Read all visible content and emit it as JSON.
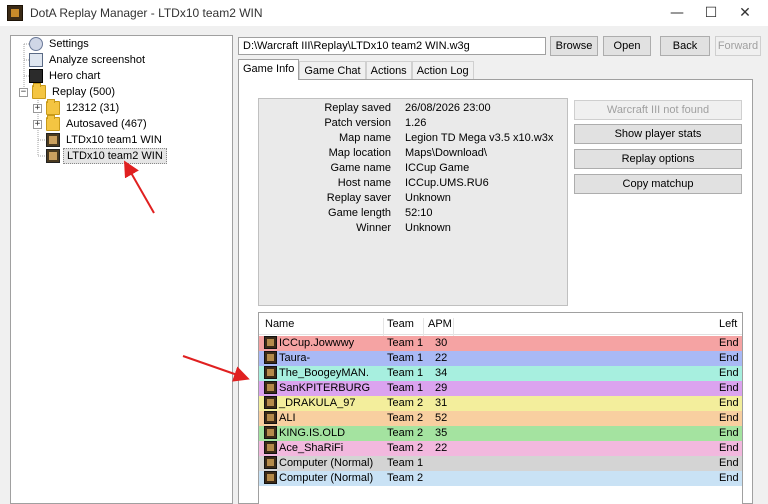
{
  "window": {
    "title": "DotA Replay Manager - LTDx10 team2 WIN",
    "minimize": "—",
    "maximize": "☐",
    "close": "✕"
  },
  "tree": {
    "items": [
      {
        "label": "Settings",
        "icon": "gear-icon"
      },
      {
        "label": "Analyze screenshot",
        "icon": "screenshot-icon"
      },
      {
        "label": "Hero chart",
        "icon": "hero-chart-icon"
      },
      {
        "label": "Replay (500)",
        "icon": "folder-icon",
        "expander": "−"
      },
      {
        "label": "12312 (31)",
        "icon": "folder-icon",
        "expander": "+"
      },
      {
        "label": "Autosaved (467)",
        "icon": "folder-icon",
        "expander": "+"
      },
      {
        "label": "LTDx10 team1 WIN",
        "icon": "replay-icon"
      },
      {
        "label": "LTDx10 team2 WIN",
        "icon": "replay-icon",
        "selected": true
      }
    ]
  },
  "toolbar": {
    "path": "D:\\Warcraft III\\Replay\\LTDx10 team2 WIN.w3g",
    "browse": "Browse",
    "open": "Open",
    "back": "Back",
    "forward": "Forward"
  },
  "tabs": [
    "Game Info",
    "Game Chat",
    "Actions",
    "Action Log"
  ],
  "info": [
    {
      "key": "Replay saved",
      "value": "26/08/2026 23:00"
    },
    {
      "key": "Patch version",
      "value": "1.26"
    },
    {
      "key": "Map name",
      "value": "Legion TD Mega v3.5 x10.w3x"
    },
    {
      "key": "Map location",
      "value": "Maps\\Download\\"
    },
    {
      "key": "Game name",
      "value": "ICCup Game"
    },
    {
      "key": "Host name",
      "value": "ICCup.UMS.RU6"
    },
    {
      "key": "Replay saver",
      "value": "Unknown"
    },
    {
      "key": "Game length",
      "value": "52:10"
    },
    {
      "key": "Winner",
      "value": "Unknown"
    }
  ],
  "side_buttons": {
    "warcraft": "Warcraft III not found",
    "stats": "Show player stats",
    "options": "Replay options",
    "copy": "Copy matchup"
  },
  "players": {
    "headers": {
      "name": "Name",
      "team": "Team",
      "apm": "APM",
      "left": "Left"
    },
    "rows": [
      {
        "name": "ICCup.Jowwwy",
        "team": "Team 1",
        "apm": "30",
        "left": "End",
        "color": "#f5a3a3"
      },
      {
        "name": "Taura-",
        "team": "Team 1",
        "apm": "22",
        "left": "End",
        "color": "#a9b9f5"
      },
      {
        "name": "The_BoogeyMAN.",
        "team": "Team 1",
        "apm": "34",
        "left": "End",
        "color": "#a7efdf"
      },
      {
        "name": "SanKPITERBURG",
        "team": "Team 1",
        "apm": "29",
        "left": "End",
        "color": "#dba3ef"
      },
      {
        "name": "_DRAKULA_97",
        "team": "Team 2",
        "apm": "31",
        "left": "End",
        "color": "#f3ee9c"
      },
      {
        "name": "ALI",
        "team": "Team 2",
        "apm": "52",
        "left": "End",
        "color": "#f8cfa0"
      },
      {
        "name": "KING.IS.OLD",
        "team": "Team 2",
        "apm": "35",
        "left": "End",
        "color": "#a4e3a0"
      },
      {
        "name": "Ace_ShaRiFi",
        "team": "Team 2",
        "apm": "22",
        "left": "End",
        "color": "#f2b8de"
      },
      {
        "name": "Computer (Normal)",
        "team": "Team 1",
        "apm": "",
        "left": "End",
        "color": "#d4d4d4"
      },
      {
        "name": "Computer (Normal)",
        "team": "Team 2",
        "apm": "",
        "left": "End",
        "color": "#c9e2f5"
      }
    ]
  }
}
